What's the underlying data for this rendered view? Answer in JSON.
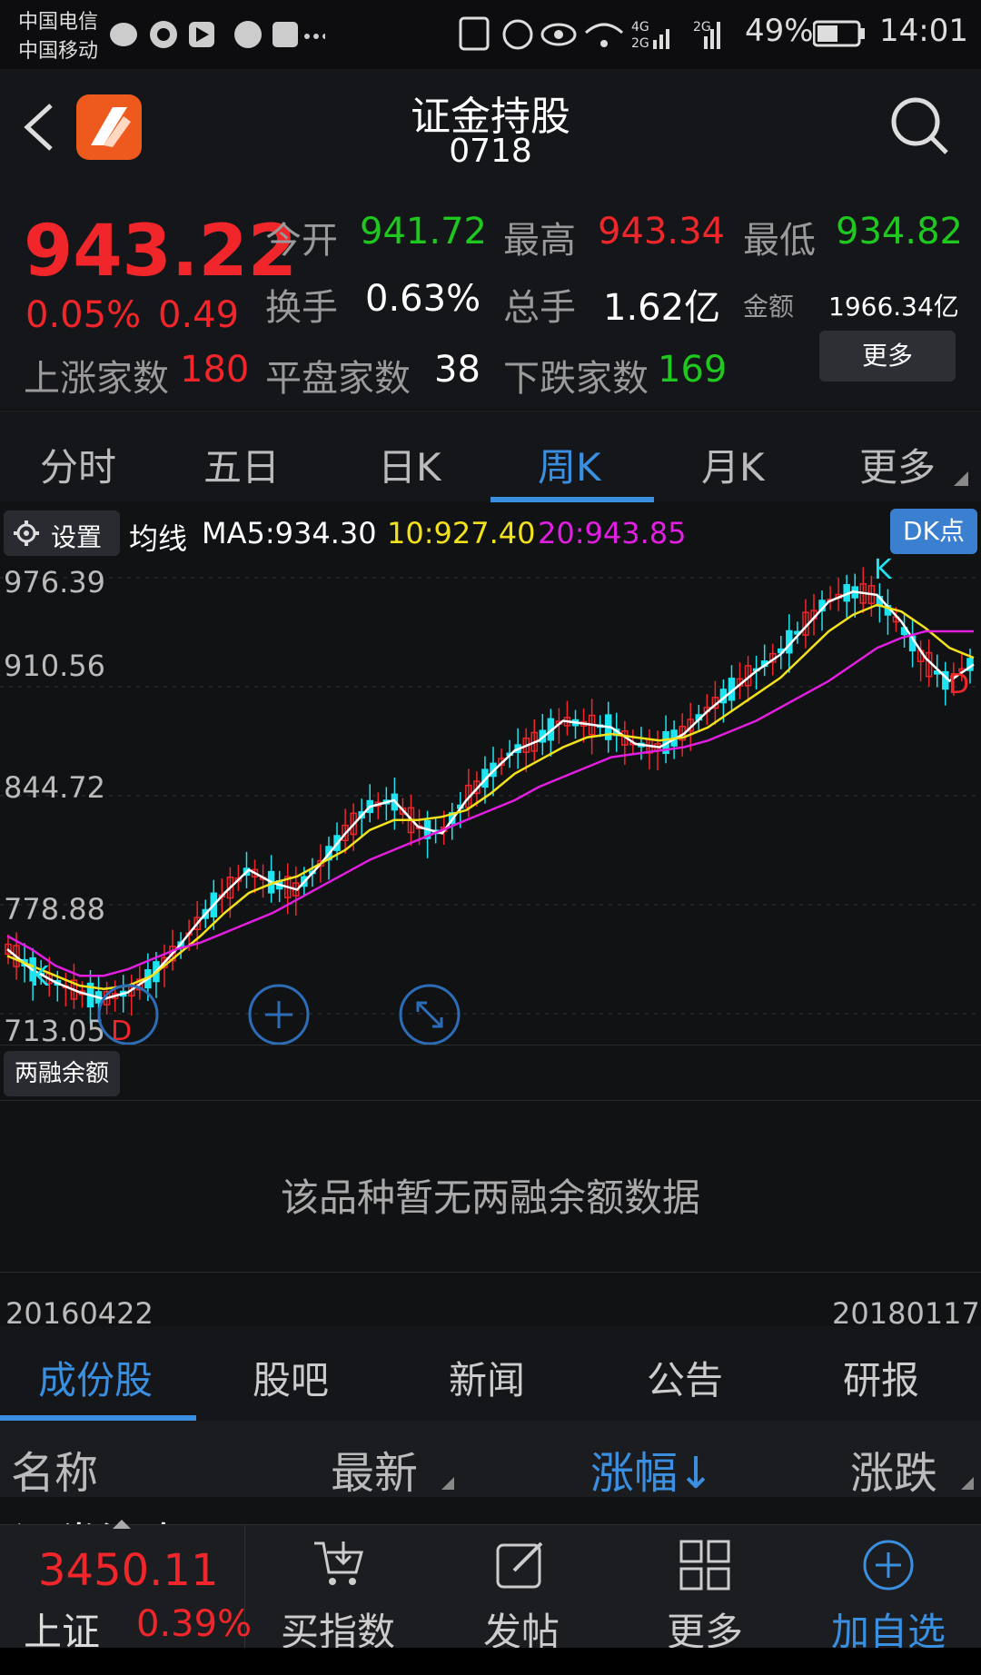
{
  "status": {
    "carrier1": "中国电信",
    "carrier2": "中国移动",
    "battery": "49%",
    "time": "14:01",
    "net1": "4G",
    "net2": "2G"
  },
  "header": {
    "title": "证金持股",
    "code": "0718"
  },
  "quote": {
    "price": "943.22",
    "change_pct": "0.05%",
    "change": "0.49",
    "open_label": "今开",
    "open": "941.72",
    "high_label": "最高",
    "high": "943.34",
    "low_label": "最低",
    "low": "934.82",
    "turnover_label": "换手",
    "turnover": "0.63%",
    "volume_label": "总手",
    "volume": "1.62亿",
    "amount_label": "金额",
    "amount": "1966.34亿",
    "up_label": "上涨家数",
    "up": "180",
    "flat_label": "平盘家数",
    "flat": "38",
    "down_label": "下跌家数",
    "down": "169",
    "more_label": "更多"
  },
  "period_tabs": [
    "分时",
    "五日",
    "日K",
    "周K",
    "月K",
    "更多"
  ],
  "active_period": "周K",
  "chart_bar": {
    "settings": "设置",
    "ma_label": "均线",
    "ma5": "MA5:934.30",
    "ma10": "10:927.40",
    "ma20": "20:943.85",
    "dk_button": "DK点"
  },
  "colors": {
    "up": "#f0262a",
    "down": "#1ec81e",
    "ma5": "#ffffff",
    "ma10": "#f3e21b",
    "ma20": "#e21ee0",
    "accent": "#3a8fe0",
    "cyan": "#1de4f0"
  },
  "chart_data": {
    "type": "line",
    "title": "",
    "y_ticks": [
      "976.39",
      "910.56",
      "844.72",
      "778.88",
      "713.05"
    ],
    "ylim": [
      713.05,
      976.39
    ],
    "x_range": [
      "20160422",
      "20180117"
    ],
    "markers": [
      "K",
      "D",
      "K",
      "D"
    ],
    "series": [
      {
        "name": "MA5",
        "values": [
          752,
          740,
          732,
          726,
          722,
          726,
          736,
          752,
          770,
          786,
          800,
          792,
          788,
          804,
          822,
          838,
          842,
          826,
          822,
          842,
          858,
          872,
          878,
          890,
          888,
          886,
          876,
          874,
          882,
          896,
          908,
          920,
          930,
          946,
          962,
          968,
          966,
          950,
          928,
          914,
          924
        ]
      },
      {
        "name": "MA10",
        "values": [
          748,
          742,
          736,
          730,
          728,
          730,
          736,
          748,
          760,
          774,
          786,
          792,
          796,
          804,
          812,
          824,
          830,
          830,
          832,
          836,
          846,
          858,
          866,
          874,
          880,
          882,
          880,
          878,
          880,
          886,
          896,
          906,
          916,
          930,
          944,
          954,
          960,
          956,
          946,
          934,
          928
        ]
      },
      {
        "name": "MA20",
        "values": [
          760,
          752,
          742,
          736,
          736,
          740,
          746,
          752,
          756,
          762,
          768,
          774,
          782,
          790,
          798,
          806,
          812,
          818,
          824,
          830,
          836,
          842,
          850,
          856,
          862,
          868,
          870,
          872,
          874,
          878,
          884,
          890,
          898,
          906,
          914,
          924,
          934,
          940,
          944,
          944,
          944
        ]
      }
    ]
  },
  "margin_panel": {
    "label": "两融余额",
    "empty_text": "该品种暂无两融余额数据"
  },
  "dates": {
    "start": "20160422",
    "end": "20180117"
  },
  "bottom_tabs": [
    "成份股",
    "股吧",
    "新闻",
    "公告",
    "研报"
  ],
  "table_header": {
    "name": "名称",
    "latest": "最新",
    "change_pct": "涨幅↓",
    "change": "涨跌"
  },
  "partial_row": "证券海专",
  "bottom_nav": {
    "index_value": "3450.11",
    "index_name": "上证",
    "index_change": "0.39%",
    "items": [
      "买指数",
      "发帖",
      "更多",
      "加自选"
    ]
  }
}
